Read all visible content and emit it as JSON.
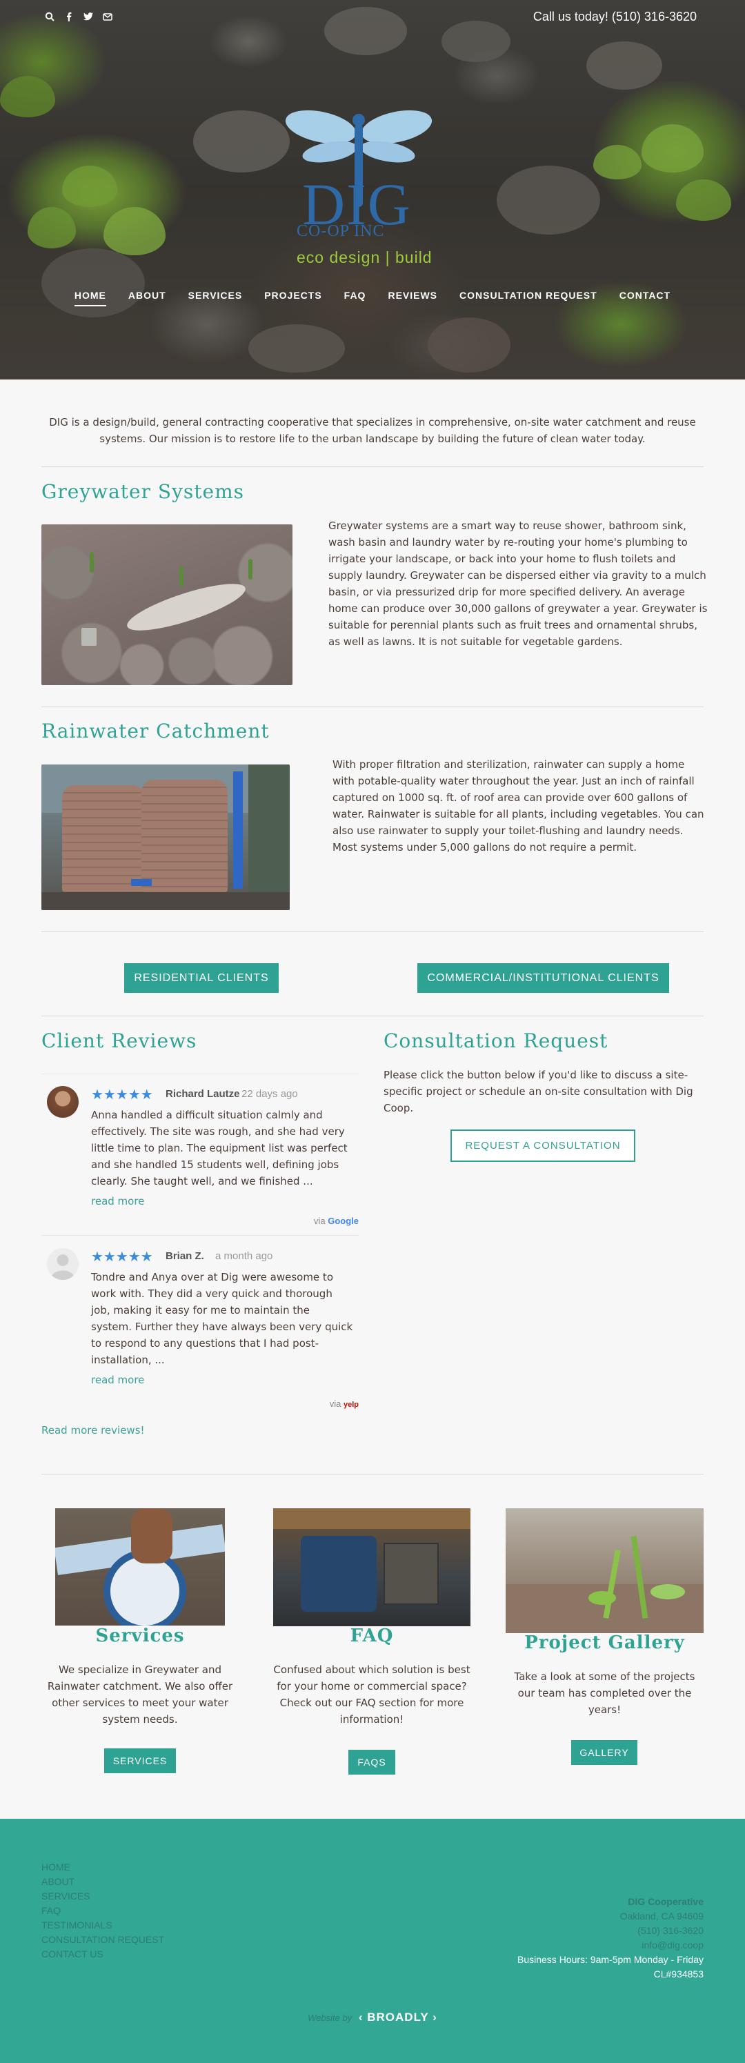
{
  "header": {
    "call_text": "Call us today! (510) 316-3620",
    "logo": {
      "name": "DIG",
      "sub": "CO-OP INC",
      "tag": "eco design | build"
    },
    "nav": [
      "HOME",
      "ABOUT",
      "SERVICES",
      "PROJECTS",
      "FAQ",
      "REVIEWS",
      "CONSULTATION REQUEST",
      "CONTACT"
    ]
  },
  "intro": "DIG is a design/build, general contracting cooperative that specializes in comprehensive, on-site water catchment and reuse systems. Our mission is to restore life to the urban landscape by building the future of clean water today.",
  "greywater": {
    "title": "Greywater Systems",
    "text": "Greywater systems are a smart way to reuse shower, bathroom sink, wash basin and laundry water by re-routing your home's plumbing to irrigate your landscape, or back into your home to flush toilets and supply laundry. Greywater can be dispersed either via gravity to a mulch basin, or via pressurized drip for more specified delivery. An average home can produce over 30,000 gallons of greywater a year. Greywater is suitable for perennial plants such as fruit trees and ornamental shrubs, as well as lawns. It is not suitable for vegetable gardens."
  },
  "rainwater": {
    "title": "Rainwater Catchment",
    "text": "With proper filtration and sterilization, rainwater can supply a home with potable-quality water throughout the year. Just an inch of rainfall captured on 1000 sq. ft. of roof area can provide over 600 gallons of water. Rainwater is suitable for all plants, including vegetables. You can also use rainwater to supply your toilet-flushing and laundry needs. Most systems under 5,000 gallons do not require a permit."
  },
  "clients": {
    "residential": "RESIDENTIAL CLIENTS",
    "commercial": "COMMERCIAL/INSTITUTIONAL CLIENTS"
  },
  "reviews": {
    "title": "Client Reviews",
    "items": [
      {
        "name": "Richard Lautze",
        "time": "22 days ago",
        "stars": 5,
        "text": "Anna handled a difficult situation calmly and effectively. The site was rough, and she had very little time to plan. The equipment list was perfect and she handled 15 students well, defining jobs clearly. She taught well, and we finished ...",
        "more": "read more",
        "via": "via",
        "source": "Google"
      },
      {
        "name": "Brian Z.",
        "time": "a month ago",
        "stars": 5,
        "text": "Tondre and Anya over at Dig were awesome to work with. They did a very quick and thorough job, making it easy for me to maintain the system. Further they have always been very quick to respond to any questions that I had post-installation, ...",
        "more": "read more",
        "via": "via",
        "source": "yelp"
      }
    ],
    "read_more": "Read more reviews!"
  },
  "consultation": {
    "title": "Consultation Request",
    "text": "Please click the button below if you'd like to discuss a site-specific project or schedule an on-site consultation with Dig Coop.",
    "button": "REQUEST A CONSULTATION"
  },
  "cards": [
    {
      "title": "Services",
      "text": "We specialize in Greywater and Rainwater catchment. We also offer other services to meet your water system needs.",
      "button": "SERVICES"
    },
    {
      "title": "FAQ",
      "text": "Confused about which solution is best for your home or commercial space? Check out our FAQ section for more information!",
      "button": "FAQS"
    },
    {
      "title": "Project Gallery",
      "text": "Take a look at some of the projects our team has completed over the years!",
      "button": "GALLERY"
    }
  ],
  "footer": {
    "links": [
      "HOME",
      "ABOUT",
      "SERVICES",
      "FAQ",
      "TESTIMONIALS",
      "CONSULTATION REQUEST",
      "CONTACT US"
    ],
    "company": "DIG Cooperative",
    "city": "Oakland, CA 94609",
    "phone": "(510) 316-3620",
    "email": "info@dig.coop",
    "hours": "Business Hours: 9am-5pm Monday - Friday",
    "license": "CL#934853",
    "website_by": "Website by",
    "brand": "BROADLY"
  },
  "colors": {
    "accent": "#31a794",
    "star": "#3b8be0",
    "logo_blue": "#2e69a8",
    "logo_green": "#9ccc3c"
  }
}
